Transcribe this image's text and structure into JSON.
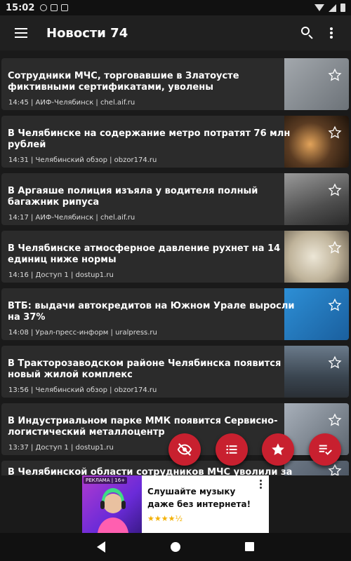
{
  "status_bar": {
    "time": "15:02",
    "notification_icons": [
      "gear-icon",
      "sim-icon",
      "sd-card-icon"
    ],
    "right_icons": [
      "wifi-icon",
      "signal-icon",
      "battery-icon"
    ]
  },
  "app_bar": {
    "title": "Новости 74",
    "icons": [
      "menu-icon",
      "search-icon",
      "more-vert-icon"
    ]
  },
  "news": [
    {
      "title": "Сотрудники МЧС, торговавшие в Златоусте фиктивными сертификатами, уволены",
      "meta": "14:45  | АИФ-Челябинск | chel.aif.ru",
      "thumb": "#8a8f95"
    },
    {
      "title": "В Челябинске на содержание метро потратят 76 млн рублей",
      "meta": "14:31  | Челябинский обзор | obzor174.ru",
      "thumb": "#5a3b22"
    },
    {
      "title": "В Аргаяше полиция изъяла у водителя полный багажник рипуса",
      "meta": "14:17  | АИФ-Челябинск | chel.aif.ru",
      "thumb": "#6f6f6f"
    },
    {
      "title": "В Челябинске атмосферное давление рухнет на 14 единиц ниже нормы",
      "meta": "14:16  | Доступ 1 | dostup1.ru",
      "thumb": "#d6cdb8"
    },
    {
      "title": "ВТБ: выдачи автокредитов на Южном Урале выросли на 37%",
      "meta": "14:08  | Урал-пресс-информ | uralpress.ru",
      "thumb": "#1f6fb0"
    },
    {
      "title": "В Тракторозаводском районе Челябинска появится новый жилой комплекс",
      "meta": "13:56  | Челябинский обзор | obzor174.ru",
      "thumb": "#4b5a6a"
    },
    {
      "title": "В Индустриальном парке ММК появится Сервисно-логистический металлоцентр",
      "meta": "13:37  | Доступ 1 | dostup1.ru",
      "thumb": "#7d8794"
    },
    {
      "title": "В Челябинской области сотрудников МЧС уволили за подделку",
      "meta": "",
      "thumb": "#556070"
    }
  ],
  "fabs": [
    "visibility-off-icon",
    "list-icon",
    "star-icon",
    "playlist-check-icon"
  ],
  "ad": {
    "label": "РЕКЛАМА | 16+",
    "text": "Слушайте музыку даже без интернета!",
    "rating": "★★★★½"
  },
  "colors": {
    "accent": "#c8202f",
    "card": "#2b2b2b",
    "background": "#1a1a1a",
    "appbar": "#202020"
  }
}
